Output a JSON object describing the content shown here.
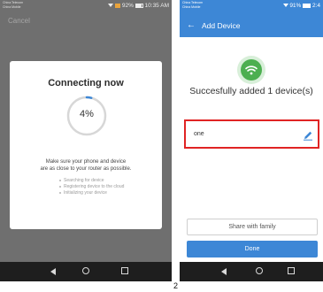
{
  "left_screen": {
    "status_bar": {
      "carrier_line1": "China Telecom",
      "carrier_line2": "China Mobile",
      "right_text": "92%",
      "time": "10:35 AM"
    },
    "cancel_label": "Cancel",
    "dialog": {
      "title": "Connecting now",
      "progress_percent": 4,
      "progress_label": "4%",
      "message_line1": "Make sure your phone and device",
      "message_line2": "are as close to your router as possible.",
      "steps": [
        "Searching for device",
        "Registering device to the cloud",
        "Initializing your device"
      ]
    }
  },
  "right_screen": {
    "status_bar": {
      "carrier_line1": "China Telecom",
      "carrier_line2": "China Mobile",
      "right_text": "91%",
      "time": "2:4"
    },
    "header_title": "Add Device",
    "success_message": "Succesfully added 1 device(s)",
    "device_name": "one",
    "share_button_label": "Share with family",
    "done_button_label": "Done"
  },
  "page_number": "2",
  "colors": {
    "accent_blue": "#3d87d6",
    "success_green": "#4caf50",
    "highlight_red": "#e02424",
    "dim_background": "#6f6f6f"
  },
  "icons": [
    "wifi-icon",
    "battery-icon",
    "back-arrow-icon",
    "edit-pencil-icon",
    "nav-back-icon",
    "nav-home-icon",
    "nav-recent-icon"
  ]
}
